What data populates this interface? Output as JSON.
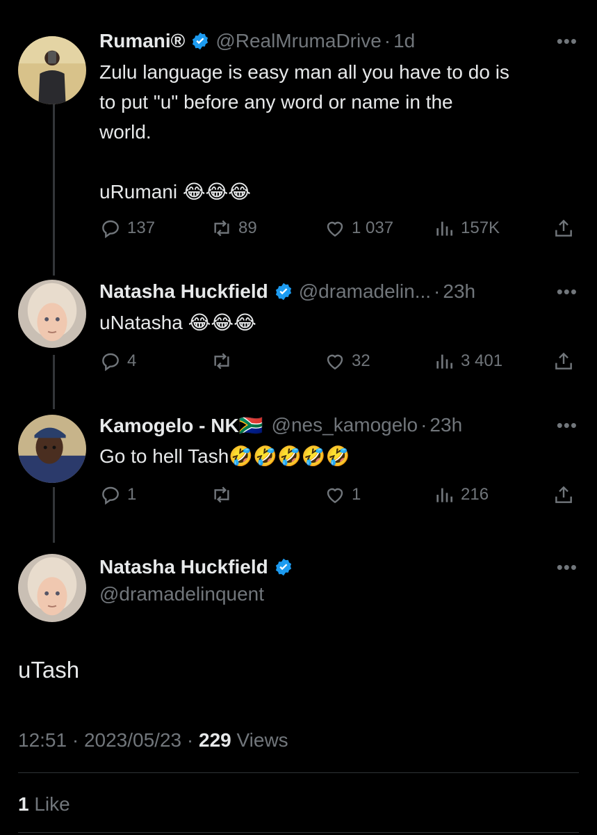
{
  "colors": {
    "background": "#000000",
    "text": "#e7e9ea",
    "muted": "#71767b",
    "verified": "#1d9bf0",
    "divider": "#2f3336"
  },
  "tweets": [
    {
      "name": "Rumani®",
      "handle": "@RealMrumaDrive",
      "dot": "·",
      "time": "1d",
      "text": "Zulu language is easy man all you have to do is\nto put \"u\" before any word or name in the\nworld.\n\nuRumani 😂😂😂",
      "replies": "137",
      "retweets": "89",
      "likes": "1 037",
      "views": "157K"
    },
    {
      "name": "Natasha Huckfield",
      "handle": "@dramadelin...",
      "dot": "·",
      "time": "23h",
      "text": "uNatasha 😂😂😂",
      "replies": "4",
      "retweets": "",
      "likes": "32",
      "views": "3 401"
    },
    {
      "name": "Kamogelo - NK🇿🇦",
      "handle": "@nes_kamogelo",
      "dot": "·",
      "time": "23h",
      "text": "Go to hell Tash🤣🤣🤣🤣🤣",
      "replies": "1",
      "retweets": "",
      "likes": "1",
      "views": "216"
    }
  ],
  "main_tweet": {
    "name": "Natasha Huckfield",
    "handle": "@dramadelinquent",
    "text": "uTash",
    "time": "12:51",
    "sep1": "·",
    "date": "2023/05/23",
    "sep2": "·",
    "views_count": "229",
    "views_label": " Views",
    "likes_count": "1",
    "likes_label": " Like"
  },
  "more_glyph": "•••"
}
